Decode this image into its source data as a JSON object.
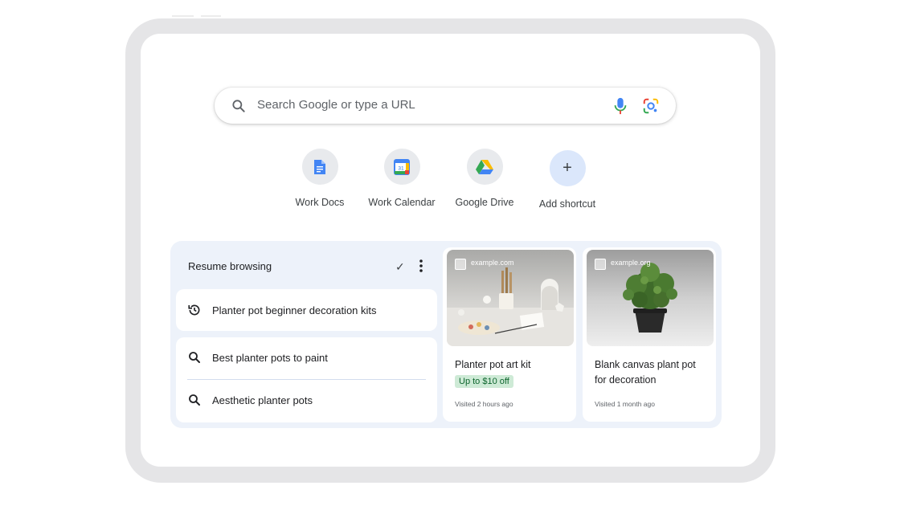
{
  "search": {
    "placeholder": "Search Google or type a URL",
    "icons": [
      "search-icon",
      "microphone-icon",
      "google-lens-icon"
    ]
  },
  "shortcuts": [
    {
      "label": "Work Docs",
      "icon": "google-docs-icon"
    },
    {
      "label": "Work Calendar",
      "icon": "google-calendar-icon"
    },
    {
      "label": "Google Drive",
      "icon": "google-drive-icon"
    },
    {
      "label": "Add shortcut",
      "icon": "plus-icon"
    }
  ],
  "resume": {
    "title": "Resume browsing",
    "history_items": [
      {
        "text": "Planter pot beginner decoration kits",
        "icon": "history-icon"
      }
    ],
    "search_items": [
      {
        "text": "Best planter pots to paint",
        "icon": "search-icon"
      },
      {
        "text": "Aesthetic planter pots",
        "icon": "search-icon"
      }
    ],
    "cards": [
      {
        "domain": "example.com",
        "title": "Planter pot art kit",
        "badge": "Up to $10 off",
        "visited": "Visited 2 hours ago"
      },
      {
        "domain": "example.org",
        "title": "Blank canvas plant pot for decoration",
        "visited": "Visited 1 month ago"
      }
    ]
  },
  "colors": {
    "panel_bg": "#edf2fa",
    "badge_bg": "#ceead6",
    "badge_text": "#0d652d",
    "accent_blue": "#4285f4"
  }
}
